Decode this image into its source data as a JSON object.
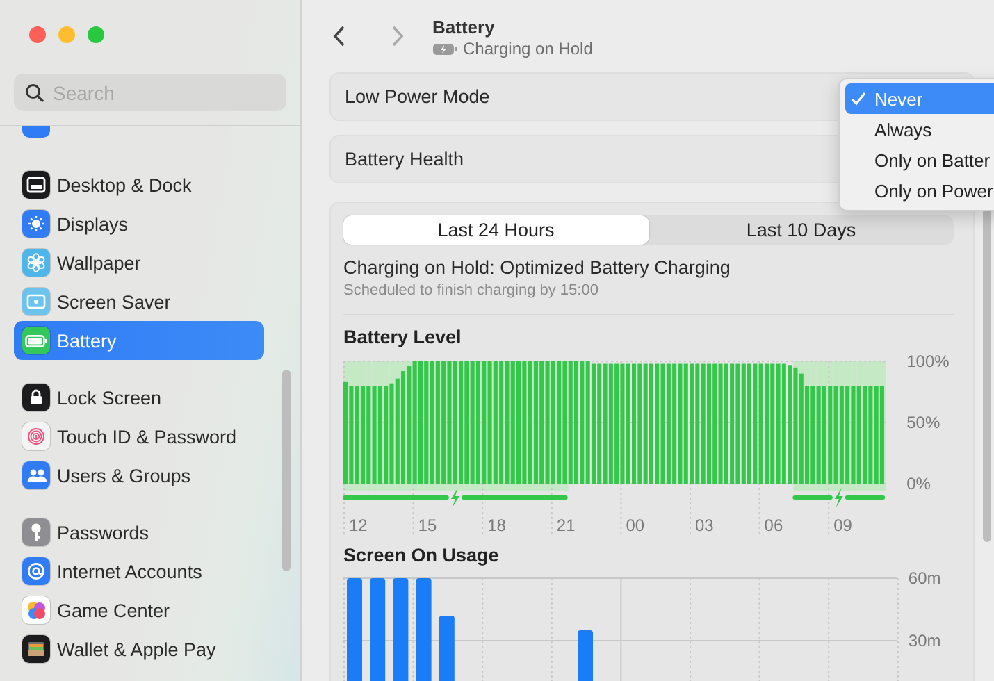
{
  "window": {
    "title": "Battery",
    "subtitle": "Charging on Hold"
  },
  "sidebar": {
    "search": {
      "placeholder": "Search"
    },
    "groups": [
      {
        "items": [
          {
            "label": "Desktop & Dock",
            "selected": false,
            "color": "#1c1c1e"
          },
          {
            "label": "Displays",
            "selected": false,
            "color": "#2f7cf6"
          },
          {
            "label": "Wallpaper",
            "selected": false,
            "color": "#4fb6ea"
          },
          {
            "label": "Screen Saver",
            "selected": false,
            "color": "#6cc4ee"
          },
          {
            "label": "Battery",
            "selected": true,
            "color": "#34c759"
          }
        ]
      },
      {
        "items": [
          {
            "label": "Lock Screen",
            "selected": false,
            "color": "#1c1c1e"
          },
          {
            "label": "Touch ID & Password",
            "selected": false,
            "color": "#f4f4f4"
          },
          {
            "label": "Users & Groups",
            "selected": false,
            "color": "#2f7cf6"
          }
        ]
      },
      {
        "items": [
          {
            "label": "Passwords",
            "selected": false,
            "color": "#8e8e93"
          },
          {
            "label": "Internet Accounts",
            "selected": false,
            "color": "#2f7cf6"
          },
          {
            "label": "Game Center",
            "selected": false,
            "color": "#ffffff"
          },
          {
            "label": "Wallet & Apple Pay",
            "selected": false,
            "color": "#1c1c1e"
          }
        ]
      }
    ]
  },
  "settings_rows": [
    {
      "label": "Low Power Mode"
    },
    {
      "label": "Battery Health"
    }
  ],
  "popup_menu": {
    "options": [
      {
        "label": "Never",
        "selected": true
      },
      {
        "label": "Always",
        "selected": false
      },
      {
        "label": "Only on Batter",
        "selected": false
      },
      {
        "label": "Only on Power",
        "selected": false
      }
    ]
  },
  "range_tabs": [
    {
      "label": "Last 24 Hours",
      "selected": true
    },
    {
      "label": "Last 10 Days",
      "selected": false
    }
  ],
  "status": {
    "title": "Charging on Hold: Optimized Battery Charging",
    "detail": "Scheduled to finish charging by 15:00"
  },
  "battery_level": {
    "title": "Battery Level",
    "time_labels": [
      "12",
      "15",
      "18",
      "21",
      "00",
      "03",
      "06",
      "09"
    ],
    "charging": [
      true,
      true,
      true,
      true,
      true,
      true,
      true,
      true,
      true,
      true,
      true,
      true,
      true,
      true,
      true,
      true,
      true,
      true,
      true,
      true,
      true,
      true,
      true,
      true,
      true,
      true,
      true,
      true,
      true,
      true,
      true,
      true,
      true,
      true,
      true,
      true,
      true,
      true,
      true,
      false,
      false,
      false,
      false,
      false,
      false,
      false,
      false,
      false,
      false,
      false,
      false,
      false,
      false,
      false,
      false,
      false,
      false,
      false,
      false,
      false,
      false,
      false,
      false,
      false,
      false,
      false,
      false,
      false,
      false,
      false,
      false,
      false,
      false,
      false,
      false,
      false,
      false,
      false,
      true,
      true,
      true,
      true,
      true,
      true,
      true,
      true,
      true,
      true,
      true,
      true,
      true,
      true,
      true,
      true
    ],
    "chart_data": {
      "type": "bar",
      "ylim": [
        0,
        100
      ],
      "yticks": [
        {
          "value": 0,
          "label": "0%"
        },
        {
          "value": 50,
          "label": "50%"
        },
        {
          "value": 100,
          "label": "100%"
        }
      ],
      "values": [
        83,
        80,
        80,
        80,
        80,
        80,
        80,
        80,
        82,
        86,
        92,
        96,
        100,
        100,
        100,
        100,
        100,
        100,
        100,
        100,
        100,
        100,
        100,
        100,
        100,
        100,
        100,
        100,
        100,
        100,
        100,
        100,
        100,
        100,
        100,
        100,
        100,
        100,
        100,
        100,
        100,
        100,
        100,
        98,
        98,
        98,
        98,
        98,
        98,
        98,
        98,
        98,
        98,
        98,
        98,
        98,
        98,
        98,
        98,
        98,
        98,
        98,
        98,
        98,
        98,
        98,
        98,
        98,
        98,
        98,
        98,
        98,
        98,
        98,
        98,
        98,
        98,
        97,
        95,
        90,
        80,
        80,
        80,
        80,
        80,
        80,
        80,
        80,
        80,
        80,
        80,
        80,
        80,
        80
      ]
    }
  },
  "screen_usage": {
    "title": "Screen On Usage",
    "chart_data": {
      "type": "bar",
      "ylim": [
        0,
        60
      ],
      "yticks": [
        {
          "value": 30,
          "label": "30m"
        },
        {
          "value": 60,
          "label": "60m"
        }
      ],
      "values": [
        60,
        60,
        60,
        60,
        42,
        null,
        null,
        null,
        null,
        null,
        35,
        null,
        null,
        null,
        null,
        null,
        null,
        null,
        null,
        null,
        null,
        null,
        null,
        null
      ]
    }
  }
}
